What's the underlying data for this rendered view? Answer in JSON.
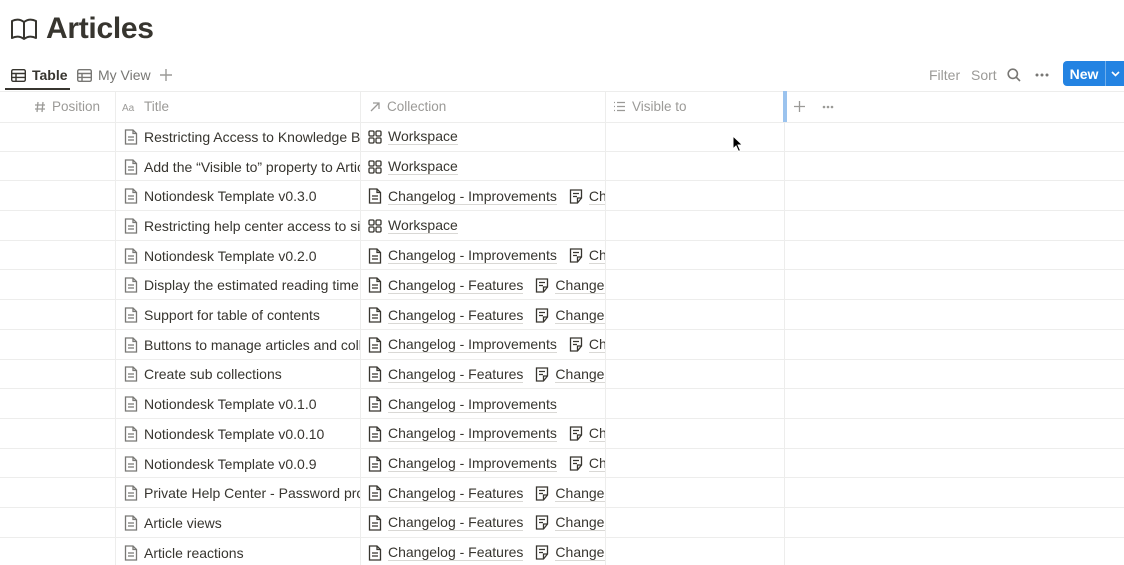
{
  "page": {
    "title": "Articles"
  },
  "views": {
    "tabs": [
      {
        "label": "Table",
        "active": true
      },
      {
        "label": "My View",
        "active": false
      }
    ]
  },
  "toolbar": {
    "filter": "Filter",
    "sort": "Sort",
    "new_label": "New"
  },
  "columns": {
    "position": "Position",
    "title": "Title",
    "collection": "Collection",
    "visible_to": "Visible to"
  },
  "rows": [
    {
      "title": "Restricting Access to Knowledge Bas",
      "collections": [
        "Workspace"
      ]
    },
    {
      "title": "Add the “Visible to” property to Artic",
      "collections": [
        "Workspace"
      ]
    },
    {
      "title": "Notiondesk Template v0.3.0",
      "collections": [
        "Changelog - Improvements",
        "Cha"
      ]
    },
    {
      "title": "Restricting help center access to sig",
      "collections": [
        "Workspace"
      ]
    },
    {
      "title": "Notiondesk Template v0.2.0",
      "collections": [
        "Changelog - Improvements",
        "Cha"
      ]
    },
    {
      "title": "Display the estimated reading time o",
      "collections": [
        "Changelog - Features",
        "Changelo"
      ]
    },
    {
      "title": "Support for table of contents",
      "collections": [
        "Changelog - Features",
        "Changelo"
      ]
    },
    {
      "title": "Buttons to manage articles and colle",
      "collections": [
        "Changelog - Improvements",
        "Cha"
      ]
    },
    {
      "title": "Create sub collections",
      "collections": [
        "Changelog - Features",
        "Changelo"
      ]
    },
    {
      "title": "Notiondesk Template v0.1.0",
      "collections": [
        "Changelog - Improvements"
      ]
    },
    {
      "title": "Notiondesk Template v0.0.10",
      "collections": [
        "Changelog - Improvements",
        "Cha"
      ]
    },
    {
      "title": "Notiondesk Template v0.0.9",
      "collections": [
        "Changelog - Improvements",
        "Cha"
      ]
    },
    {
      "title": "Private Help Center - Password prote",
      "collections": [
        "Changelog - Features",
        "Changelo"
      ]
    },
    {
      "title": "Article views",
      "collections": [
        "Changelog - Features",
        "Changelo"
      ]
    },
    {
      "title": "Article reactions",
      "collections": [
        "Changelog - Features",
        "Changelo"
      ]
    }
  ],
  "icons": {
    "page": "book-icon",
    "row": "page-icon",
    "workspace_chip": "grid-icon",
    "changelog_chip": "page-icon",
    "second_chip": "list-page-icon"
  }
}
